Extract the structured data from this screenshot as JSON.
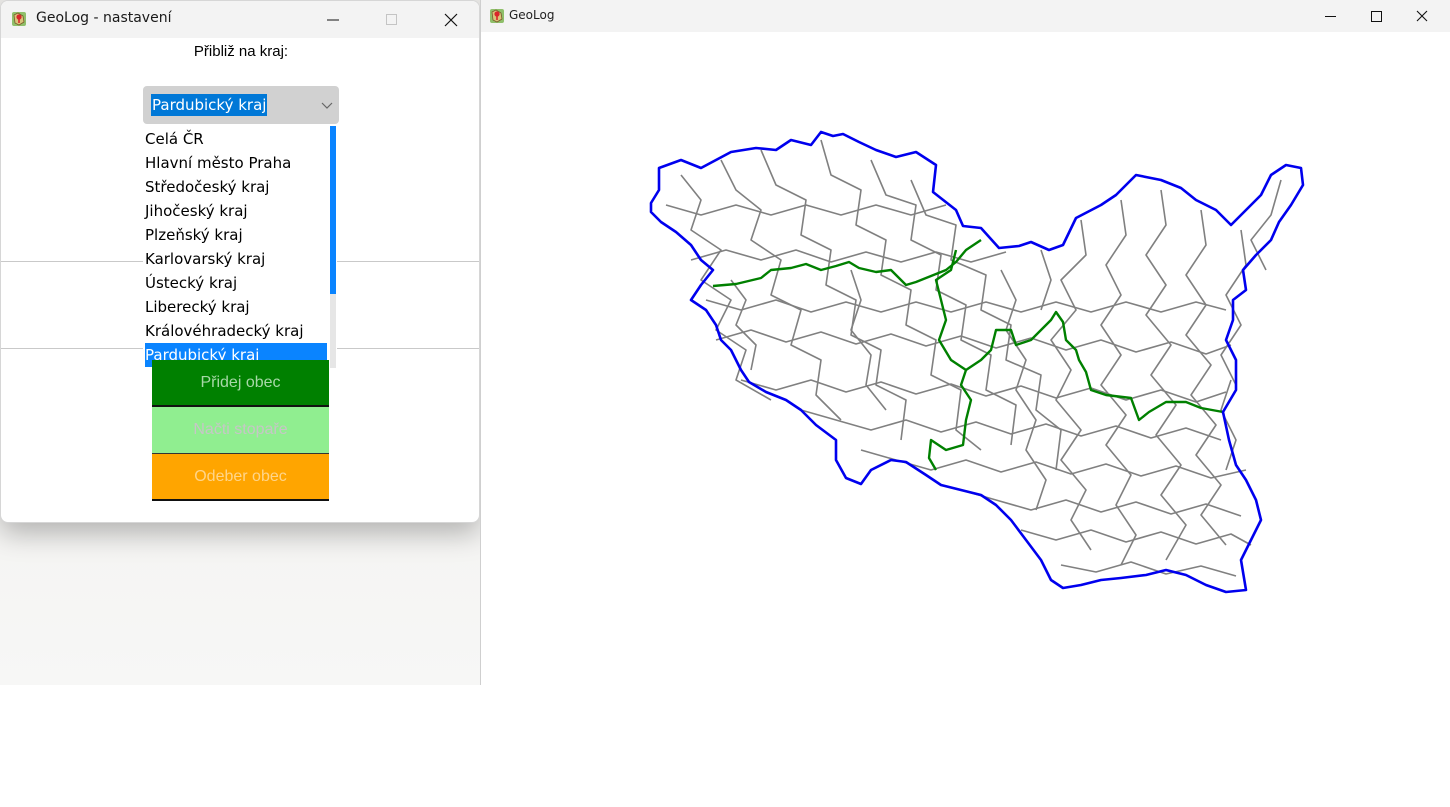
{
  "settings_window": {
    "title": "GeoLog - nastavení",
    "zoom_label": "Přibliž na kraj:",
    "region_select": {
      "selected": "Pardubický kraj",
      "options": [
        "Celá ČR",
        "Hlavní město Praha",
        "Středočeský kraj",
        "Jihočeský kraj",
        "Plzeňský kraj",
        "Karlovarský kraj",
        "Ústecký kraj",
        "Liberecký kraj",
        "Královéhradecký kraj",
        "Pardubický kraj"
      ]
    },
    "buttons": {
      "add": "Přidej obec",
      "load": "Načti stopaře",
      "remove": "Odeber obec"
    }
  },
  "map_window": {
    "title": "GeoLog",
    "icons": [
      "minimize-icon",
      "maximize-icon",
      "close-icon"
    ]
  },
  "colors": {
    "region_border": "#0000ee",
    "district_border": "#008000",
    "municipality_border": "#808080",
    "add_button": "#008000",
    "load_button": "#90ee90",
    "remove_button": "#ffa500",
    "selection": "#0a84ff"
  }
}
